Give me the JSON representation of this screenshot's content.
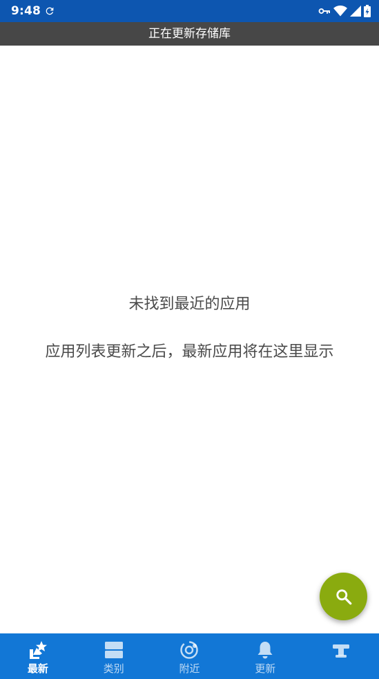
{
  "status_bar": {
    "time": "9:48",
    "sync_icon": "sync-icon",
    "icons": [
      "vpn-key-icon",
      "wifi-icon",
      "signal-icon",
      "battery-charging-icon"
    ]
  },
  "banner": {
    "text": "正在更新存储库"
  },
  "empty_state": {
    "title": "未找到最近的应用",
    "description": "应用列表更新之后，最新应用将在这里显示"
  },
  "fab": {
    "icon": "search-icon"
  },
  "bottom_nav": {
    "items": [
      {
        "label": "最新",
        "icon": "latest-star-icon",
        "active": true
      },
      {
        "label": "类别",
        "icon": "categories-icon",
        "active": false
      },
      {
        "label": "附近",
        "icon": "nearby-icon",
        "active": false
      },
      {
        "label": "更新",
        "icon": "bell-icon",
        "active": false
      },
      {
        "label": "",
        "icon": "settings-icon",
        "active": false
      }
    ]
  },
  "colors": {
    "status_bar": "#0d56b0",
    "banner": "#474747",
    "fab": "#8aab0f",
    "bottom_nav": "#1277d6"
  }
}
